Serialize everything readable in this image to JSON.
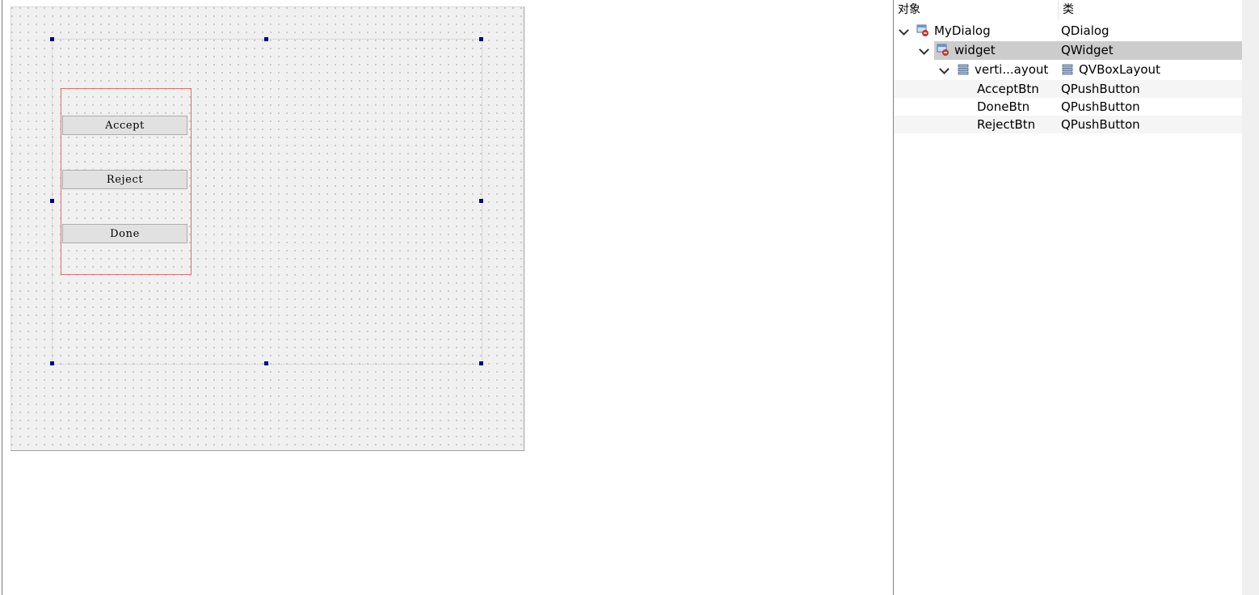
{
  "form": {
    "buttons": {
      "accept": "Accept",
      "reject": "Reject",
      "done": "Done"
    }
  },
  "inspector": {
    "header": {
      "object_col": "对象",
      "class_col": "类"
    },
    "rows": [
      {
        "name": "MyDialog",
        "class": "QDialog",
        "icon": "widget-icon"
      },
      {
        "name": "widget",
        "class": "QWidget",
        "icon": "widget-icon"
      },
      {
        "name": "verti...ayout",
        "class": "QVBoxLayout",
        "icon": "vbox-layout-icon"
      },
      {
        "name": "AcceptBtn",
        "class": "QPushButton"
      },
      {
        "name": "DoneBtn",
        "class": "QPushButton"
      },
      {
        "name": "RejectBtn",
        "class": "QPushButton"
      }
    ],
    "selected_row": "widget"
  },
  "colors": {
    "selection": "#cccccc",
    "handle": "#000080",
    "layout_border": "#e07070",
    "form_background": "#f0f0f0"
  }
}
